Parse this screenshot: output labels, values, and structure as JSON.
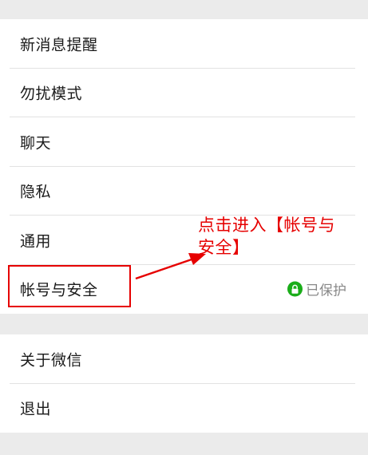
{
  "settings_groups": [
    {
      "items": [
        {
          "label": "新消息提醒"
        },
        {
          "label": "勿扰模式"
        },
        {
          "label": "聊天"
        },
        {
          "label": "隐私"
        },
        {
          "label": "通用"
        },
        {
          "label": "帐号与安全",
          "status": "已保护"
        }
      ]
    },
    {
      "items": [
        {
          "label": "关于微信"
        },
        {
          "label": "退出"
        }
      ]
    }
  ],
  "annotation": {
    "note": "点击进入【帐号与安全】"
  },
  "colors": {
    "page_background": "#ebebeb",
    "annotation_red": "#e60000",
    "lock_green": "#1aad19"
  }
}
